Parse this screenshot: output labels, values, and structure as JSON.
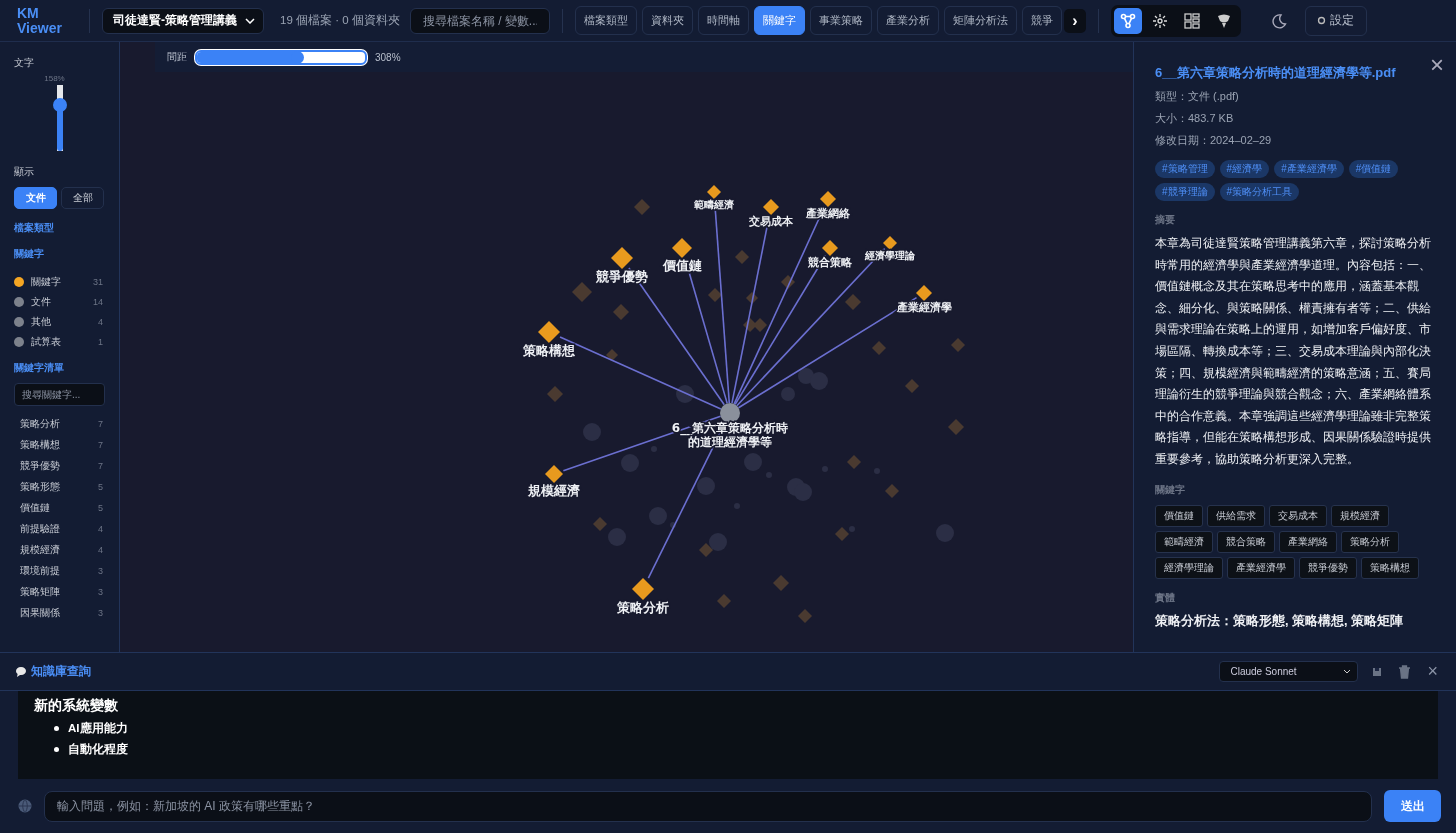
{
  "app": {
    "logo_lines": [
      "KM",
      "Viewer"
    ]
  },
  "top_bar": {
    "library": "司徒達賢-策略管理講義",
    "counts": "19 個檔案 · 0 個資料夾",
    "search": {
      "placeholder": "搜尋檔案名稱 / 變數..."
    },
    "tabs": [
      {
        "label": "檔案類型",
        "selected": false
      },
      {
        "label": "資料夾",
        "selected": false
      },
      {
        "label": "時間軸",
        "selected": false
      },
      {
        "label": "關鍵字",
        "selected": true
      },
      {
        "label": "事業策略",
        "selected": false
      },
      {
        "label": "產業分析",
        "selected": false
      },
      {
        "label": "矩陣分析法",
        "selected": false
      },
      {
        "label": "競爭",
        "selected": false
      }
    ],
    "tab_scroll": "›",
    "views": [
      {
        "kind": "graph",
        "selected": true
      },
      {
        "kind": "burst",
        "selected": false
      },
      {
        "kind": "grid",
        "selected": false
      },
      {
        "kind": "tree",
        "selected": false
      }
    ],
    "settings": "設定"
  },
  "sidebar": {
    "text_size": {
      "label": "文字",
      "reading": "158%",
      "level": 0.7
    },
    "display": {
      "label": "顯示",
      "options": [
        {
          "label": "文件",
          "selected": true
        },
        {
          "label": "全部",
          "selected": false
        }
      ]
    },
    "sections": [
      "檔案類型",
      "關鍵字"
    ],
    "legend": [
      {
        "label": "關鍵字",
        "count": "31",
        "color": "#f5a623"
      },
      {
        "label": "文件",
        "count": "14",
        "color": "#7d828c"
      },
      {
        "label": "其他",
        "count": "4",
        "color": "#7d828c"
      },
      {
        "label": "試算表",
        "count": "1",
        "color": "#7d828c"
      }
    ],
    "keyword_list": {
      "title": "關鍵字清單",
      "search": {
        "placeholder": "搜尋關鍵字..."
      },
      "items": [
        {
          "label": "策略分析",
          "count": "7"
        },
        {
          "label": "策略構想",
          "count": "7"
        },
        {
          "label": "競爭優勢",
          "count": "7"
        },
        {
          "label": "策略形態",
          "count": "5"
        },
        {
          "label": "價值鏈",
          "count": "5"
        },
        {
          "label": "前提驗證",
          "count": "4"
        },
        {
          "label": "規模經濟",
          "count": "4"
        },
        {
          "label": "環境前提",
          "count": "3"
        },
        {
          "label": "策略矩陣",
          "count": "3"
        },
        {
          "label": "因果關係",
          "count": "3"
        }
      ]
    }
  },
  "graph": {
    "spacing": {
      "label": "間距",
      "level": 0.6,
      "reading": "308%"
    },
    "center": {
      "label_lines": [
        "6__第六章策略分析時",
        "的道理經濟學等"
      ]
    },
    "nodes": [
      {
        "label": "範疇經濟"
      },
      {
        "label": "交易成本"
      },
      {
        "label": "產業網絡"
      },
      {
        "label": "競合策略"
      },
      {
        "label": "經濟學理論"
      },
      {
        "label": "產業經濟學"
      },
      {
        "label": "價值鏈"
      },
      {
        "label": "競爭優勢"
      },
      {
        "label": "策略構想"
      },
      {
        "label": "規模經濟"
      },
      {
        "label": "策略分析"
      }
    ]
  },
  "detail": {
    "title": "6__第六章策略分析時的道理經濟學等.pdf",
    "close": "×",
    "meta": [
      "類型：文件 (.pdf)",
      "大小：483.7 KB",
      "修改日期：2024–02–29"
    ],
    "tags": [
      "#策略管理",
      "#經濟學",
      "#產業經濟學",
      "#價值鏈",
      "#競爭理論",
      "#策略分析工具"
    ],
    "summary_title": "摘要",
    "summary": "本章為司徒達賢策略管理講義第六章，探討策略分析時常用的經濟學與產業經濟學道理。內容包括：一、價值鏈概念及其在策略思考中的應用，涵蓋基本觀念、細分化、與策略關係、權責擁有者等；二、供給與需求理論在策略上的運用，如增加客戶偏好度、市場區隔、轉換成本等；三、交易成本理論與內部化決策；四、規模經濟與範疇經濟的策略意涵；五、賽局理論衍生的競爭理論與競合觀念；六、產業網絡體系中的合作意義。本章強調這些經濟學理論雖非完整策略指導，但能在策略構想形成、因果關係驗證時提供重要參考，協助策略分析更深入完整。",
    "keywords_title": "關鍵字",
    "keywords": [
      "價值鏈",
      "供給需求",
      "交易成本",
      "規模經濟",
      "範疇經濟",
      "競合策略",
      "產業網絡",
      "策略分析",
      "經濟學理論",
      "產業經濟學",
      "競爭優勢",
      "策略構想"
    ],
    "entities_title": "實體",
    "entities": [
      "**策略分析法**：策略形態, 策略構想, 策略矩陣"
    ]
  },
  "chat": {
    "title": "知識庫查詢",
    "model": "Claude Sonnet",
    "close": "×",
    "message": {
      "heading": "新的系統變數",
      "bullets": [
        "AI應用能力",
        "自動化程度"
      ]
    },
    "input": {
      "placeholder": "輸入問題，例如：新加坡的 AI 政策有哪些重點？"
    },
    "send": "送出"
  }
}
